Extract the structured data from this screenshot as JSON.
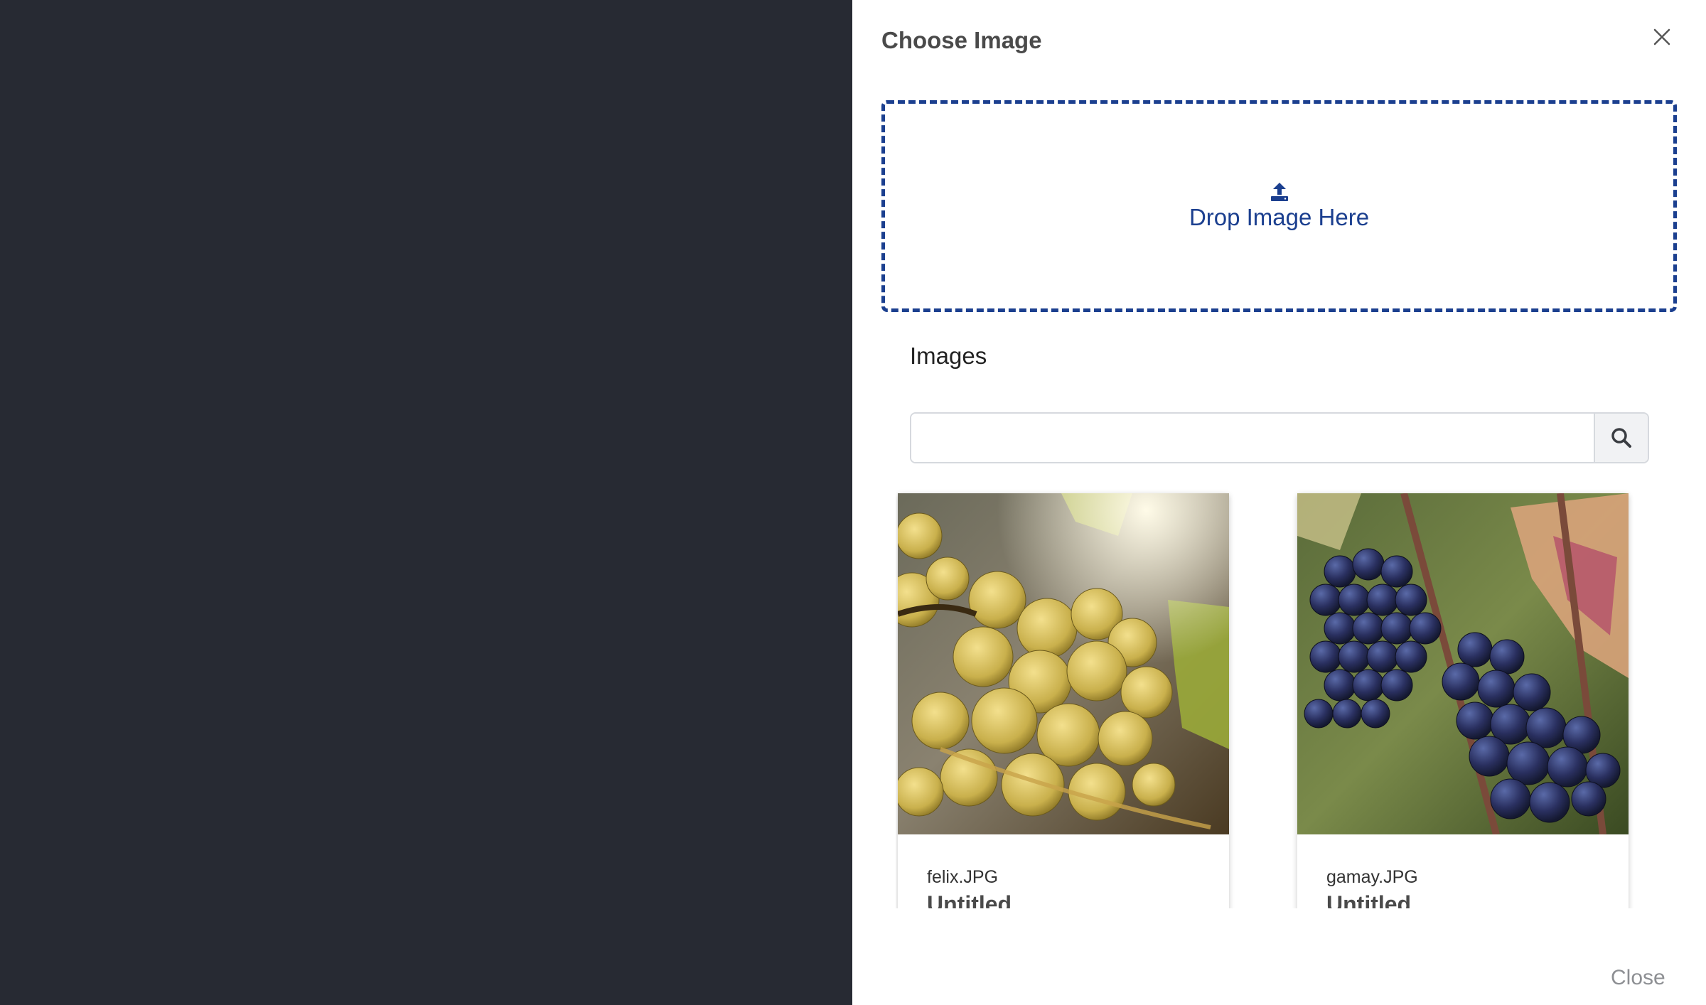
{
  "dialog": {
    "title": "Choose Image",
    "close_icon": "close-icon"
  },
  "dropzone": {
    "icon": "upload-icon",
    "label": "Drop Image Here",
    "accent_color": "#1b3f8f"
  },
  "images_section": {
    "heading": "Images",
    "search": {
      "value": "",
      "placeholder": "",
      "icon": "search-icon"
    },
    "cards": [
      {
        "filename": "felix.JPG",
        "title": "Untitled",
        "thumbnail": "white-grapes-photo"
      },
      {
        "filename": "gamay.JPG",
        "title": "Untitled",
        "thumbnail": "dark-grapes-photo"
      }
    ]
  },
  "footer": {
    "close_label": "Close"
  },
  "colors": {
    "backdrop": "#272a33",
    "panel": "#ffffff",
    "accent": "#1b3f8f"
  }
}
